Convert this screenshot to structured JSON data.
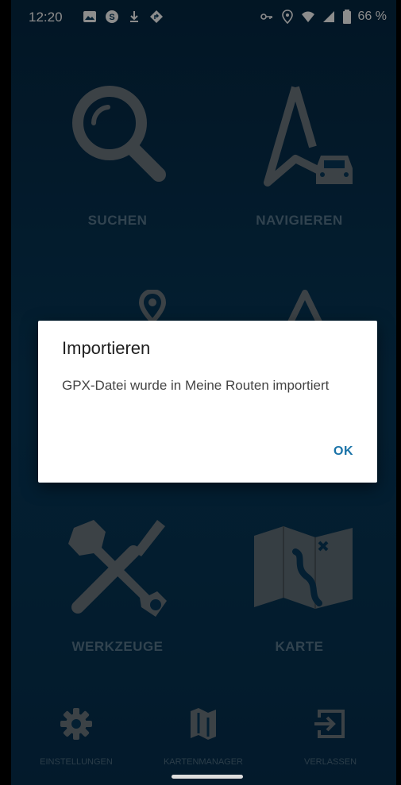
{
  "statusbar": {
    "time": "12:20",
    "battery": "66 %",
    "left_icons": [
      "image-icon",
      "skype-icon",
      "download-icon",
      "navigation-icon"
    ],
    "right_icons": [
      "key-icon",
      "location-icon",
      "wifi-icon",
      "signal-icon",
      "battery-icon"
    ]
  },
  "menu": {
    "search_label": "SUCHEN",
    "navigate_label": "NAVIGIEREN",
    "tools_label": "WERKZEUGE",
    "map_label": "KARTE"
  },
  "dialog": {
    "title": "Importieren",
    "message": "GPX-Datei wurde in Meine Routen importiert",
    "ok_label": "OK"
  },
  "bottombar": {
    "settings_label": "EINSTELLUNGEN",
    "mapmanager_label": "KARTENMANAGER",
    "exit_label": "VERLASSEN"
  },
  "colors": {
    "background": "#083a5c",
    "tile_icon": "#6e7880",
    "label": "#5a7a90",
    "ok_button": "#1a73a8"
  }
}
